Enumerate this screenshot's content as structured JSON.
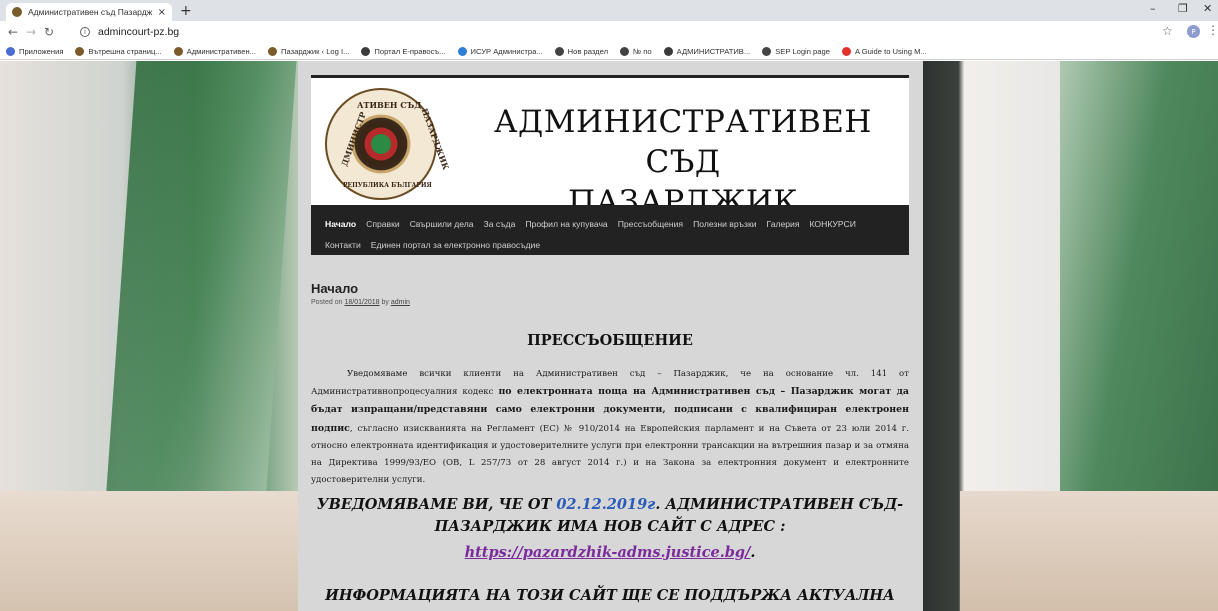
{
  "browser": {
    "tab_title": "Административен съд Пазардж",
    "tab_close": "×",
    "new_tab": "+",
    "window_minimize": "–",
    "window_restore": "❐",
    "window_close": "✕",
    "url": "admincourt-pz.bg",
    "profile_initial": "P",
    "bookmarks": [
      {
        "label": "Приложения",
        "color": "#4a6cd4"
      },
      {
        "label": "Вътрешна страниц...",
        "color": "#7a5b2a"
      },
      {
        "label": "Административен...",
        "color": "#7a5b2a"
      },
      {
        "label": "Пазарджик ‹ Log I...",
        "color": "#7a5b2a"
      },
      {
        "label": "Портал Е-правосъ...",
        "color": "#3b3b3b"
      },
      {
        "label": "ИСУР Администра...",
        "color": "#2f7fd6"
      },
      {
        "label": "Нов раздел",
        "color": "#444444"
      },
      {
        "label": "№ по",
        "color": "#444444"
      },
      {
        "label": "АДМИНИСТРАТИВ...",
        "color": "#3b3b3b"
      },
      {
        "label": "SEP Login page",
        "color": "#444444"
      },
      {
        "label": "A Guide to Using M...",
        "color": "#e0322b"
      }
    ]
  },
  "site": {
    "title_line1": "АДМИНИСТРАТИВЕН СЪД",
    "title_line2": "ПАЗАРДЖИК",
    "logo_text_top": "АТИВЕН СЪД",
    "logo_text_left": "ДМИНИСТР",
    "logo_text_right": "ПАЗАРДЖИК",
    "logo_text_bottom": "РЕПУБЛИКА БЪЛГАРИЯ",
    "menu_row1": [
      "Начало",
      "Справки",
      "Свършили дела",
      "За съда",
      "Профил на купувача",
      "Прессъобщения",
      "Полезни връзки",
      "Галерия",
      "КОНКУРСИ"
    ],
    "menu_row2": [
      "Контакти",
      "Единен портал за електронно правосъдие"
    ]
  },
  "post": {
    "title": "Начало",
    "posted_on": "Posted on",
    "date": "18/01/2018",
    "by": "by",
    "author": "admin",
    "press_heading": "ПРЕССЪОБЩЕНИЕ",
    "body_part1": "Уведомяваме всички клиенти на Административен съд – Пазарджик, че на основание чл. 141 от Административнопроцесуалния кодекс ",
    "body_bold": "по електронната поща на Административен съд – Пазарджик могат да бъдат изпращани/представяни само електронни документи, подписани с квалифициран електронен подпис",
    "body_part2": ", съгласно изискванията на Регламент (ЕС) № 910/2014 на Европейския парламент и на Съвета от 23 юли 2014 г. относно електронната идентификация и удостоверителните услуги при електронни трансакции на вътрешния пазар и за отмяна на Директива 1999/93/ЕО (ОВ, L 257/73 от 28 август 2014 г.) и на Закона за електронния документ и електронните удостоверителни услуги.",
    "notice_prefix": "УВЕДОМЯВАМЕ ВИ, ЧЕ ОТ ",
    "notice_date": "02.12.2019г",
    "notice_suffix": ". АДМИНИСТРАТИВЕН СЪД-ПАЗАРДЖИК ИМА НОВ САЙТ С АДРЕС :",
    "new_site_link": "https://pazardzhik-adms.justice.bg/",
    "link_period": ".",
    "notice2": "ИНФОРМАЦИЯТА НА ТОЗИ САЙТ ЩЕ СЕ ПОДДЪРЖА АКТУАЛНА ДО"
  }
}
